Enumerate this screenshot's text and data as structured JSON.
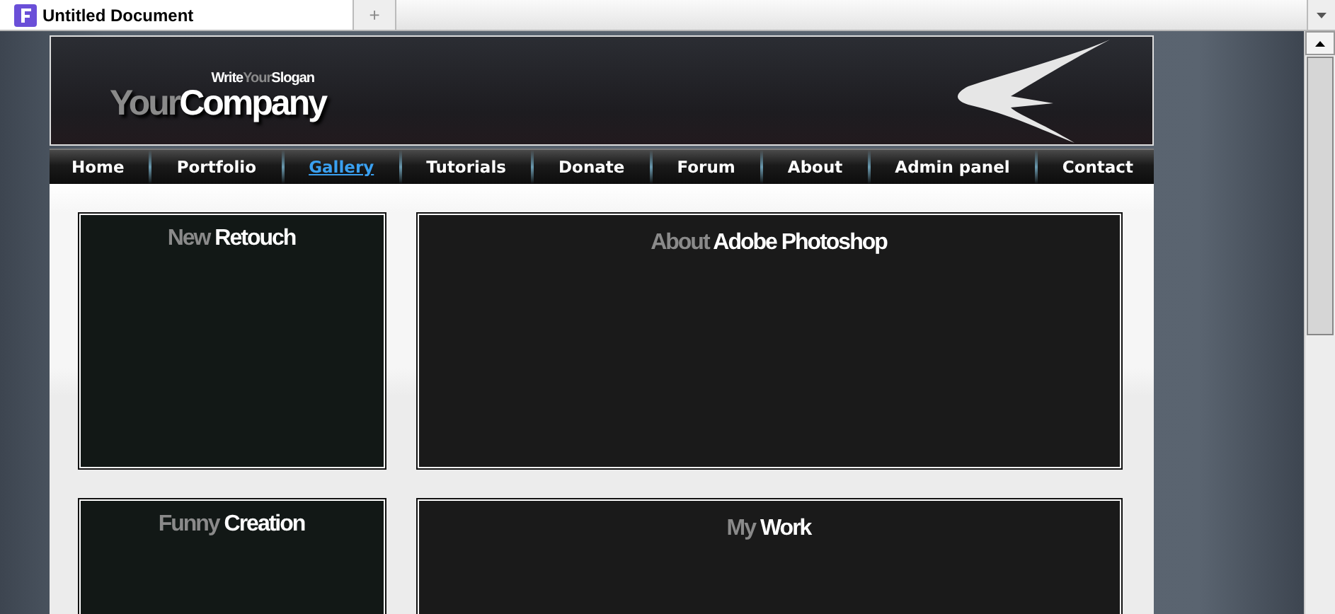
{
  "browser": {
    "tab_title": "Untitled Document",
    "new_tab": "+"
  },
  "header": {
    "slogan": {
      "first": "Write",
      "muted": "Your",
      "last": "Slogan"
    },
    "logo": {
      "muted": "Your",
      "main": "Company"
    }
  },
  "nav": [
    {
      "label": "Home",
      "selected": false
    },
    {
      "label": "Portfolio",
      "selected": false
    },
    {
      "label": "Gallery",
      "selected": true
    },
    {
      "label": "Tutorials",
      "selected": false
    },
    {
      "label": "Donate",
      "selected": false
    },
    {
      "label": "Forum",
      "selected": false
    },
    {
      "label": "About",
      "selected": false
    },
    {
      "label": "Admin panel",
      "selected": false
    },
    {
      "label": "Contact",
      "selected": false
    }
  ],
  "panels": [
    {
      "muted": "New",
      "main": "Retouch",
      "kind": "narrow"
    },
    {
      "muted": "About",
      "main": "Adobe Photoshop",
      "kind": "wide"
    },
    {
      "muted": "Funny",
      "main": "Creation",
      "kind": "narrow"
    },
    {
      "muted": "My",
      "main": "Work",
      "kind": "wide"
    }
  ]
}
